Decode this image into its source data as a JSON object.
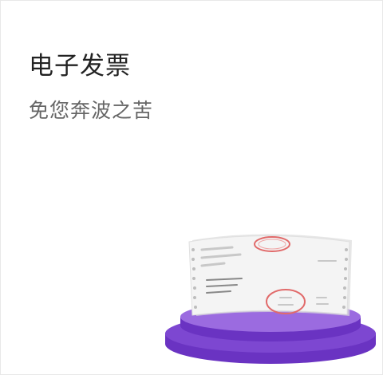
{
  "card": {
    "title": "电子发票",
    "subtitle": "免您奔波之苦"
  },
  "illustration": {
    "icon": "electronic-invoice-on-podium-icon",
    "colors": {
      "podium_top": "#9b6be0",
      "podium_side": "#6a33c2",
      "paper": "#f4f4f4",
      "paper_shadow": "#dcdcdc",
      "stamp": "#e16a6a"
    }
  }
}
